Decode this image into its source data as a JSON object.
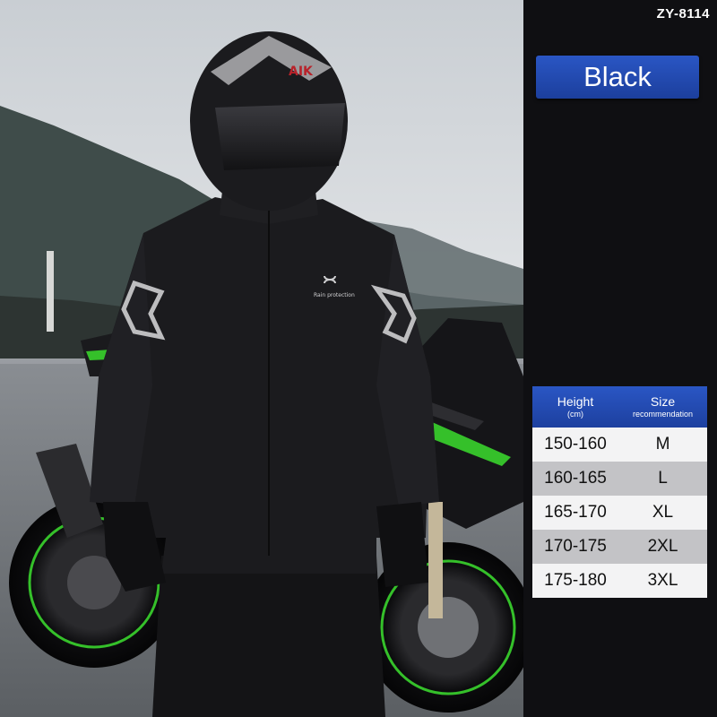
{
  "product": {
    "model_code": "ZY-8114",
    "color_label": "Black",
    "jacket_print": "Rain protection",
    "helmet_brand": "AIK"
  },
  "size_table": {
    "headers": [
      {
        "main": "Height",
        "sub": "(cm)"
      },
      {
        "main": "Size",
        "sub": "recommendation"
      }
    ],
    "rows": [
      {
        "height": "150-160",
        "size": "M"
      },
      {
        "height": "160-165",
        "size": "L"
      },
      {
        "height": "165-170",
        "size": "XL"
      },
      {
        "height": "170-175",
        "size": "2XL"
      },
      {
        "height": "175-180",
        "size": "3XL"
      }
    ]
  },
  "colors": {
    "accent_blue": "#2a56c4",
    "panel_background": "#0f0f12",
    "row_light": "#f3f3f4",
    "row_dark": "#c3c3c6",
    "bike_green": "#35c02a"
  }
}
